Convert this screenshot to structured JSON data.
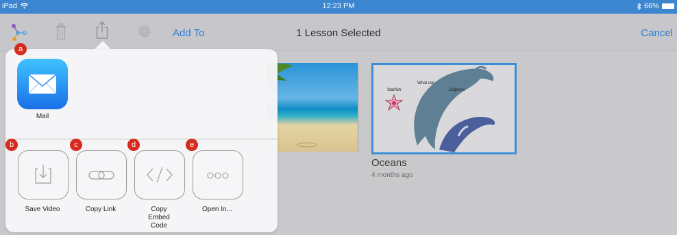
{
  "status": {
    "left": "iPad",
    "time": "12:23 PM",
    "battery": "66%"
  },
  "toolbar": {
    "add_to": "Add To",
    "title": "1 Lesson Selected",
    "cancel": "Cancel"
  },
  "card": {
    "title": "Oceans",
    "subtitle": "4 months ago",
    "labels": [
      "Starfish",
      "What can",
      "Dolphins"
    ]
  },
  "share": {
    "app_label": "Mail",
    "actions": [
      {
        "label": "Save Video",
        "badge": "b"
      },
      {
        "label": "Copy Link",
        "badge": "c"
      },
      {
        "label": "Copy Embed Code",
        "badge": "d"
      },
      {
        "label": "Open In...",
        "badge": "e"
      }
    ],
    "top_badge": "a"
  },
  "colors": {
    "accent": "#2a7ad6",
    "status_bar": "#3c86d0",
    "badge": "#d62c1f",
    "selected_border": "#3c8fd6"
  }
}
